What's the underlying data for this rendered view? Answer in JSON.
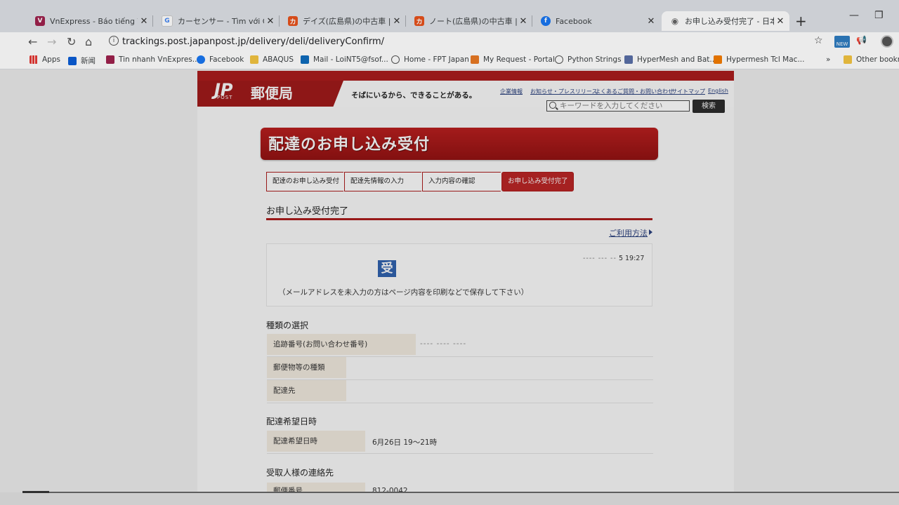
{
  "tabs": [
    {
      "title": "VnExpress - Báo tiếng Việt nh",
      "favicon": "V",
      "color": "#9f224e"
    },
    {
      "title": "カーセンサー - Tìm với Google",
      "favicon": "G",
      "color": "#4285f4"
    },
    {
      "title": "デイズ(広島県)の中古車 | 中古",
      "favicon": "カ",
      "color": "#e8531d"
    },
    {
      "title": "ノート(広島県)の中古車 | 中古",
      "favicon": "カ",
      "color": "#e8531d"
    },
    {
      "title": "Facebook",
      "favicon": "f",
      "color": "#1877f2"
    },
    {
      "title": "お申し込み受付完了 - 日本郵",
      "favicon": "◉",
      "color": "#666666"
    }
  ],
  "url": "trackings.post.japanpost.jp/delivery/deli/deliveryConfirm/",
  "bookmarks": [
    {
      "label": "Apps",
      "color": "#e53935"
    },
    {
      "label": "新闻",
      "color": "#0b5ed7"
    },
    {
      "label": "Tin nhanh VnExpres...",
      "color": "#9f224e"
    },
    {
      "label": "Facebook",
      "color": "#1877f2"
    },
    {
      "label": "ABAQUS",
      "color": "#f4c542"
    },
    {
      "label": "Mail - LoiNT5@fsof...",
      "color": "#0f6cbd"
    },
    {
      "label": "Home - FPT Japan",
      "color": "#555555"
    },
    {
      "label": "My Request - Portal",
      "color": "#ea7a24"
    },
    {
      "label": "Python Strings",
      "color": "#555555"
    },
    {
      "label": "HyperMesh and Bat...",
      "color": "#5a6fa8"
    },
    {
      "label": "Hypermesh Tcl Mac...",
      "color": "#f57c00"
    },
    {
      "label": "»",
      "color": "#ffffff"
    },
    {
      "label": "Other bookm",
      "color": "#f4c542"
    }
  ],
  "site": {
    "logo_mark": "JP",
    "logo_post": "POST",
    "logo_text": "郵便局",
    "tagline": "そばにいるから、できることがある。",
    "header_links": [
      "企業情報",
      "お知らせ・プレスリリース",
      "よくあるご質問・お問い合わせ",
      "サイトマップ",
      "English"
    ],
    "search_placeholder": "キーワードを入力してください",
    "search_button": "検索"
  },
  "banner_title": "配達のお申し込み受付",
  "steps": [
    "配達のお申し込み受付",
    "配達先情報の入力",
    "入力内容の確認",
    "お申し込み受付完了"
  ],
  "section_title": "お申し込み受付完了",
  "howto": "ご利用方法",
  "received": {
    "stamp": "受",
    "datetime": "5 19:27",
    "note": "（メールアドレスを未入力の方はページ内容を印刷などで保存して下さい）"
  },
  "kind_section": "種類の選択",
  "kind_rows": [
    {
      "label": "追跡番号(お問い合わせ番号)",
      "value": ""
    },
    {
      "label": "郵便物等の種類",
      "value": ""
    },
    {
      "label": "配達先",
      "value": ""
    }
  ],
  "desired_section": "配達希望日時",
  "desired_rows": [
    {
      "label": "配達希望日時",
      "value": "6月26日 19〜21時"
    }
  ],
  "contact_section": "受取人様の連絡先",
  "contact_rows": [
    {
      "label": "郵便番号",
      "value": "812-0042"
    }
  ]
}
